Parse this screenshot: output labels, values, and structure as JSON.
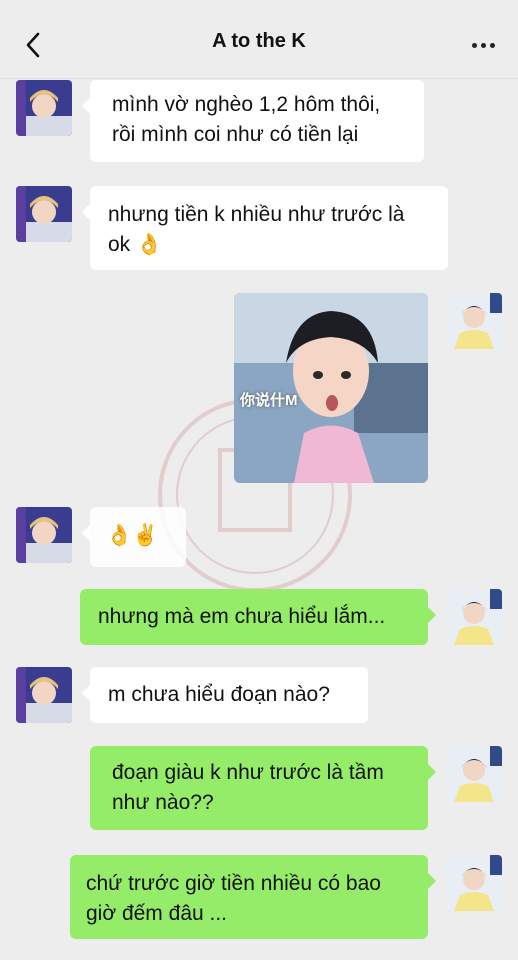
{
  "header": {
    "title": "A to the K",
    "back_icon": "chevron-left-icon",
    "more_icon": "more-dots-icon"
  },
  "messages": [
    {
      "side": "left",
      "text": "mình vờ nghèo 1,2 hôm thôi,\nrồi mình coi như có tiền lại"
    },
    {
      "side": "left",
      "text": "nhưng tiền k nhiều như trước là\nok 👌"
    },
    {
      "side": "right",
      "type": "image",
      "caption": "你说什M"
    },
    {
      "side": "left",
      "text": "👌✌"
    },
    {
      "side": "right",
      "text": "nhưng mà em chưa hiểu lắm..."
    },
    {
      "side": "left",
      "text": "m chưa hiểu đoạn nào?"
    },
    {
      "side": "right",
      "text": "đoạn giàu k như trước là tầm\nnhư nào??"
    },
    {
      "side": "right",
      "text": "chứ trước giờ tiền nhiều có bao\ngiờ đếm đâu ..."
    }
  ],
  "colors": {
    "background": "#ededed",
    "bubble_incoming": "#ffffff",
    "bubble_outgoing": "#95ec69"
  }
}
